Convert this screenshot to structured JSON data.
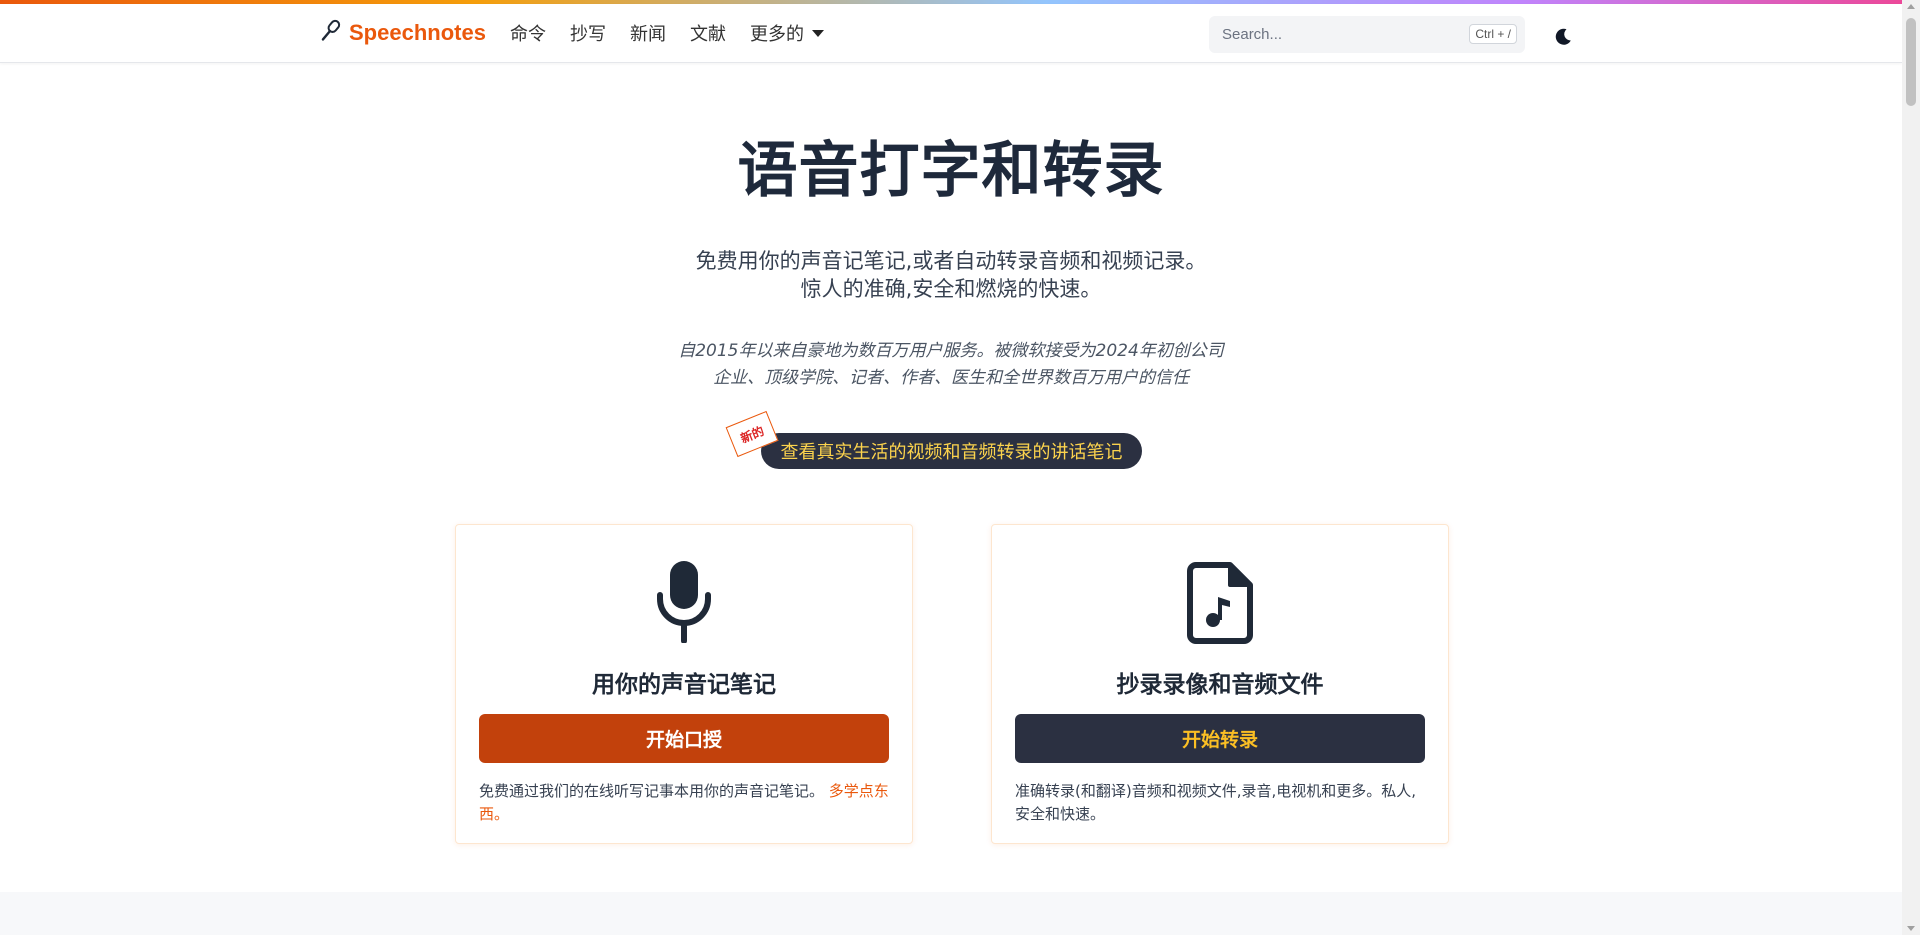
{
  "colors": {
    "brand": "#ea580c",
    "dark_pill": "#2b3041",
    "orange_button": "#c2410c",
    "yellow_text": "#fcd34d",
    "title": "#1e293b"
  },
  "navbar": {
    "brand_icon": "microphone-icon",
    "brand_name": "Speechnotes",
    "links": [
      "命令",
      "抄写",
      "新闻",
      "文献",
      "更多的"
    ],
    "search_placeholder": "Search...",
    "search_shortcut": "Ctrl + /",
    "theme_icon": "moon-icon"
  },
  "hero": {
    "title": "语音打字和转录",
    "subtitle_line1": "免费用你的声音记笔记,或者自动转录音频和视频记录。",
    "subtitle_line2": "惊人的准确,安全和燃烧的快速。",
    "trust_line1": "自2015年以来自豪地为数百万用户服务。被微软接受为2024年初创公司",
    "trust_line2": "企业、顶级学院、记者、作者、医生和全世界数百万用户的信任",
    "new_badge": "新的",
    "pill_label": "查看真实生活的视频和音频转录的讲话笔记"
  },
  "cards": {
    "dictation": {
      "icon": "microphone-icon",
      "title": "用你的声音记笔记",
      "button": "开始口授",
      "description": "免费通过我们的在线听写记事本用你的声音记笔记。",
      "learn_more": "多学点东西。"
    },
    "transcription": {
      "icon": "audio-file-icon",
      "title": "抄录录像和音频文件",
      "button": "开始转录",
      "description": "准确转录(和翻译)音频和视频文件,录音,电视机和更多。私人,安全和快速。"
    }
  }
}
